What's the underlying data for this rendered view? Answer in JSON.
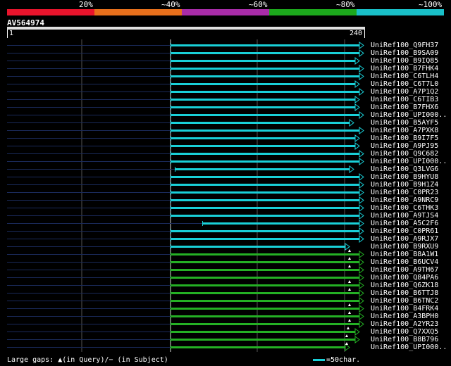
{
  "legend": {
    "labels": [
      "20%",
      "~40%",
      "~60%",
      "~80%",
      "~100%"
    ],
    "colors": [
      "#e8142c",
      "#e8701c",
      "#a82ca8",
      "#1ca81c",
      "#19c0c8"
    ]
  },
  "query": {
    "id": "AV564974",
    "start": "1",
    "end": "240"
  },
  "hit_colors": {
    "cyan": "#19d0d8",
    "green": "#24b024",
    "left_line": "#1a2a5a"
  },
  "hits": [
    {
      "name": "UniRef100_Q9FH37",
      "color": "cyan"
    },
    {
      "name": "UniRef100_B9SA09",
      "color": "cyan"
    },
    {
      "name": "UniRef100_B9IQ85",
      "color": "cyan"
    },
    {
      "name": "UniRef100_B7FHK4",
      "color": "cyan"
    },
    {
      "name": "UniRef100_C6TLH4",
      "color": "cyan"
    },
    {
      "name": "UniRef100_C6T7L0",
      "color": "cyan"
    },
    {
      "name": "UniRef100_A7P1Q2",
      "color": "cyan"
    },
    {
      "name": "UniRef100_C6TIB3",
      "color": "cyan"
    },
    {
      "name": "UniRef100_B7FHX6",
      "color": "cyan"
    },
    {
      "name": "UniRef100_UPI000..",
      "color": "cyan"
    },
    {
      "name": "UniRef100_B5AYF5",
      "color": "cyan"
    },
    {
      "name": "UniRef100_A7PXK8",
      "color": "cyan"
    },
    {
      "name": "UniRef100_B9I7F5",
      "color": "cyan"
    },
    {
      "name": "UniRef100_A9PJ95",
      "color": "cyan"
    },
    {
      "name": "UniRef100_Q9C682",
      "color": "cyan"
    },
    {
      "name": "UniRef100_UPI000..",
      "color": "cyan"
    },
    {
      "name": "UniRef100_Q3LVG6",
      "color": "cyan"
    },
    {
      "name": "UniRef100_B9HYU8",
      "color": "cyan"
    },
    {
      "name": "UniRef100_B9H1Z4",
      "color": "cyan"
    },
    {
      "name": "UniRef100_C0PR23",
      "color": "cyan"
    },
    {
      "name": "UniRef100_A9NRC9",
      "color": "cyan"
    },
    {
      "name": "UniRef100_C6THK3",
      "color": "cyan"
    },
    {
      "name": "UniRef100_A9TJS4",
      "color": "cyan"
    },
    {
      "name": "UniRef100_A5C2F6",
      "color": "cyan"
    },
    {
      "name": "UniRef100_C0PR61",
      "color": "cyan"
    },
    {
      "name": "UniRef100_A9RJX7",
      "color": "cyan"
    },
    {
      "name": "UniRef100_B9RXU9",
      "color": "cyan"
    },
    {
      "name": "UniRef100_B8A1W1",
      "color": "green"
    },
    {
      "name": "UniRef100_B6UCV4",
      "color": "green"
    },
    {
      "name": "UniRef100_A9TH67",
      "color": "green"
    },
    {
      "name": "UniRef100_Q84PA6",
      "color": "green"
    },
    {
      "name": "UniRef100_Q6ZK18",
      "color": "green"
    },
    {
      "name": "UniRef100_B6TTJ8",
      "color": "green"
    },
    {
      "name": "UniRef100_B6TNC2",
      "color": "green"
    },
    {
      "name": "UniRef100_B4FRK4",
      "color": "green"
    },
    {
      "name": "UniRef100_A3BPH0",
      "color": "green"
    },
    {
      "name": "UniRef100_A2YR23",
      "color": "green"
    },
    {
      "name": "UniRef100_Q7XXQ5",
      "color": "green"
    },
    {
      "name": "UniRef100_B8B796",
      "color": "green"
    },
    {
      "name": "UniRef100_UPI000..",
      "color": "green"
    }
  ],
  "footer": {
    "gap_legend": "Large gaps: ▲(in Query)/− (in Subject)",
    "scale": "=50char."
  }
}
